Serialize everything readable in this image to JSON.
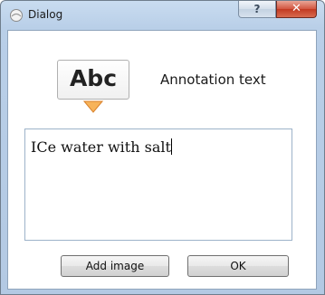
{
  "window": {
    "title": "Dialog",
    "help_label": "?",
    "close_label": "✕"
  },
  "annotation": {
    "preview_text": "Abc",
    "heading": "Annotation text",
    "text_value": "ICe water with salt"
  },
  "buttons": {
    "add_image": "Add image",
    "ok": "OK"
  },
  "colors": {
    "arrow_fill": "#f5a623",
    "close_button": "#c9452c"
  }
}
